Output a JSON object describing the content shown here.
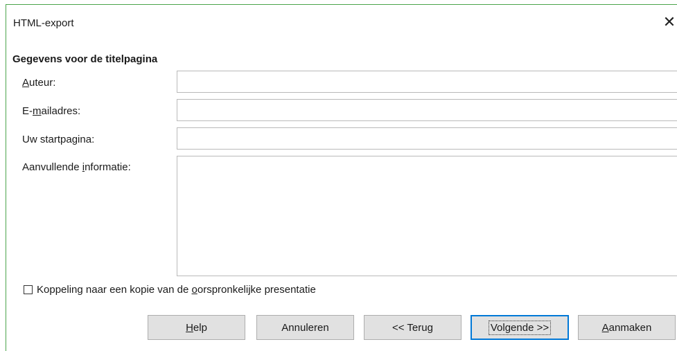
{
  "window": {
    "title": "HTML-export"
  },
  "section": {
    "title": "Gegevens voor de titelpagina"
  },
  "fields": {
    "author": {
      "label_pre": "",
      "label_u": "A",
      "label_post": "uteur:",
      "value": ""
    },
    "email": {
      "label_pre": "E-",
      "label_u": "m",
      "label_post": "ailadres:",
      "value": ""
    },
    "homepage": {
      "label_pre": "Uw startpa",
      "label_u": "g",
      "label_post": "ina:",
      "value": ""
    },
    "info": {
      "label_pre": "Aanvullende ",
      "label_u": "i",
      "label_post": "nformatie:",
      "value": ""
    }
  },
  "checkbox": {
    "checked": false,
    "label_pre": "Koppeling naar een kopie van de ",
    "label_u": "o",
    "label_post": "orspronkelijke presentatie"
  },
  "buttons": {
    "help": {
      "pre": "",
      "u": "H",
      "post": "elp"
    },
    "cancel": {
      "label": "Annuleren"
    },
    "back": {
      "label": "<< Terug"
    },
    "next": {
      "label": "Volgende >>"
    },
    "create": {
      "pre": "",
      "u": "A",
      "post": "anmaken"
    }
  },
  "icons": {
    "close": "close-icon"
  },
  "colors": {
    "default_button_border": "#0078d7",
    "window_border": "#4aa34a"
  }
}
